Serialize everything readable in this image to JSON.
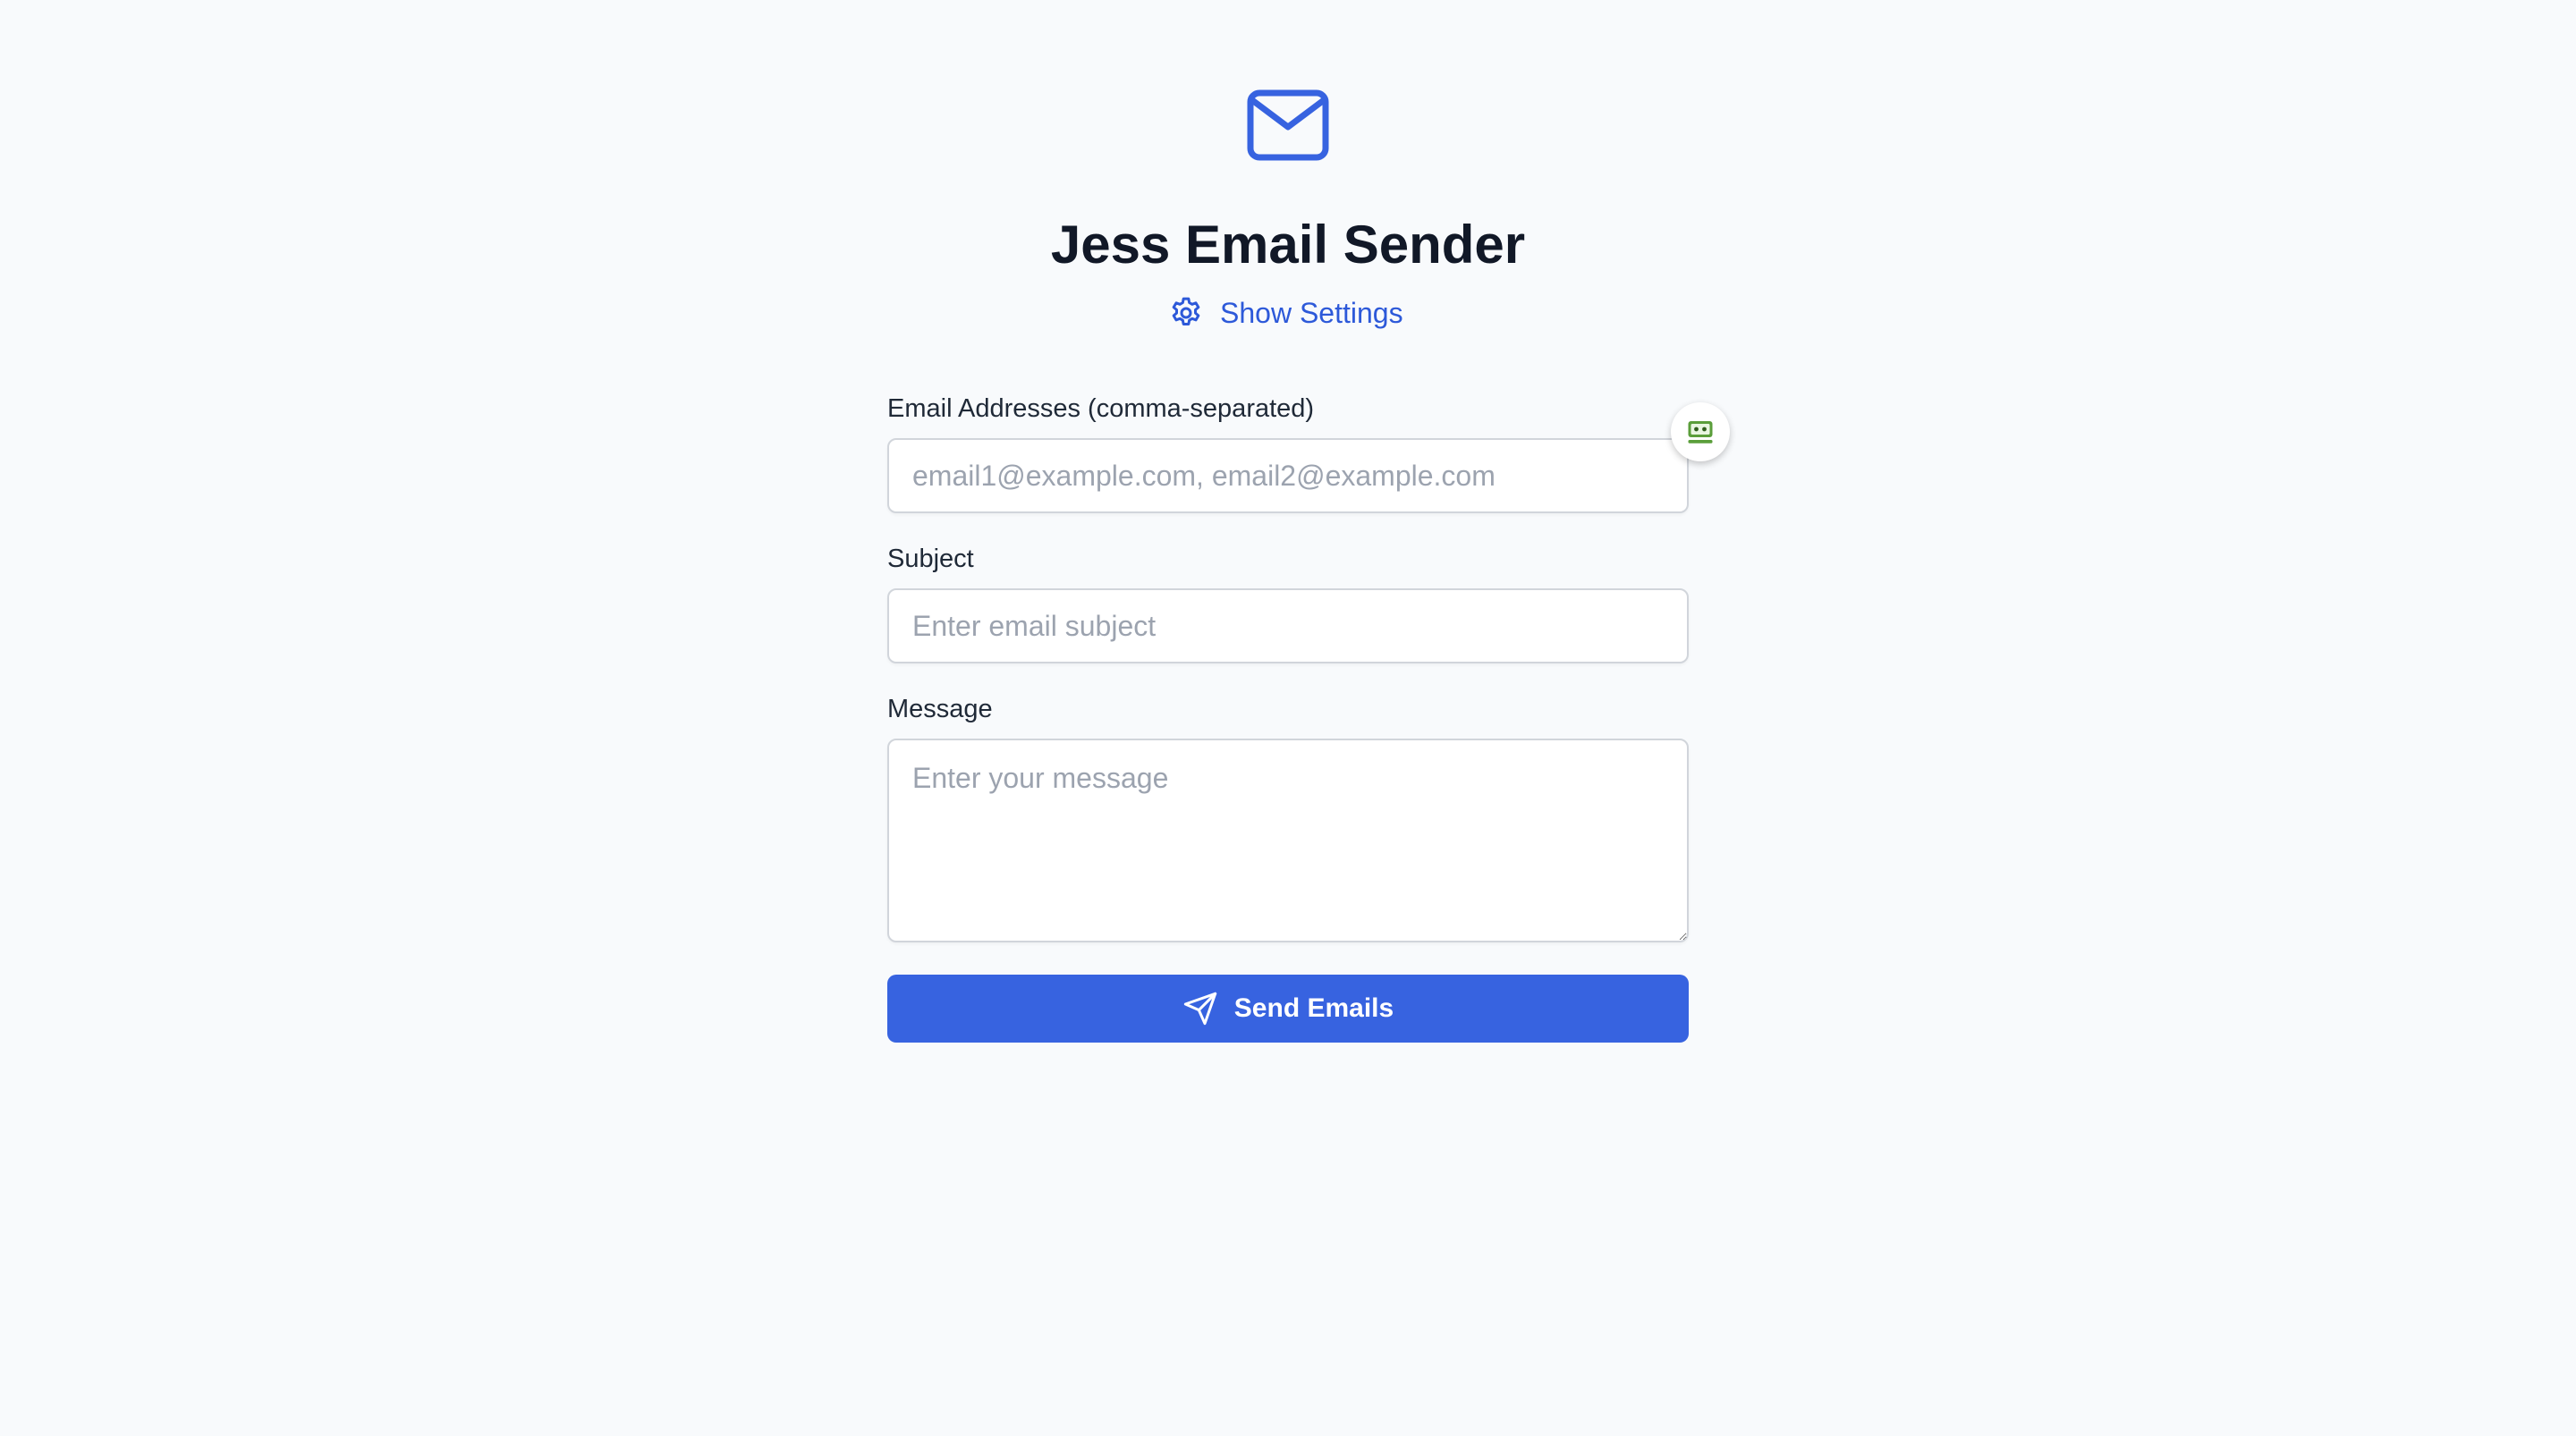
{
  "header": {
    "icon": "mail-icon",
    "title": "Jess Email Sender",
    "settings_label": "Show Settings",
    "settings_icon": "gear-icon"
  },
  "form": {
    "emails": {
      "label": "Email Addresses (comma-separated)",
      "placeholder": "email1@example.com, email2@example.com",
      "value": ""
    },
    "subject": {
      "label": "Subject",
      "placeholder": "Enter email subject",
      "value": ""
    },
    "message": {
      "label": "Message",
      "placeholder": "Enter your message",
      "value": ""
    },
    "send": {
      "label": "Send Emails",
      "icon": "send-icon"
    }
  },
  "extension": {
    "icon": "password-manager-icon"
  },
  "colors": {
    "accent": "#3763e0",
    "link": "#2d59d9",
    "title": "#111827",
    "background": "#f8fafc"
  }
}
